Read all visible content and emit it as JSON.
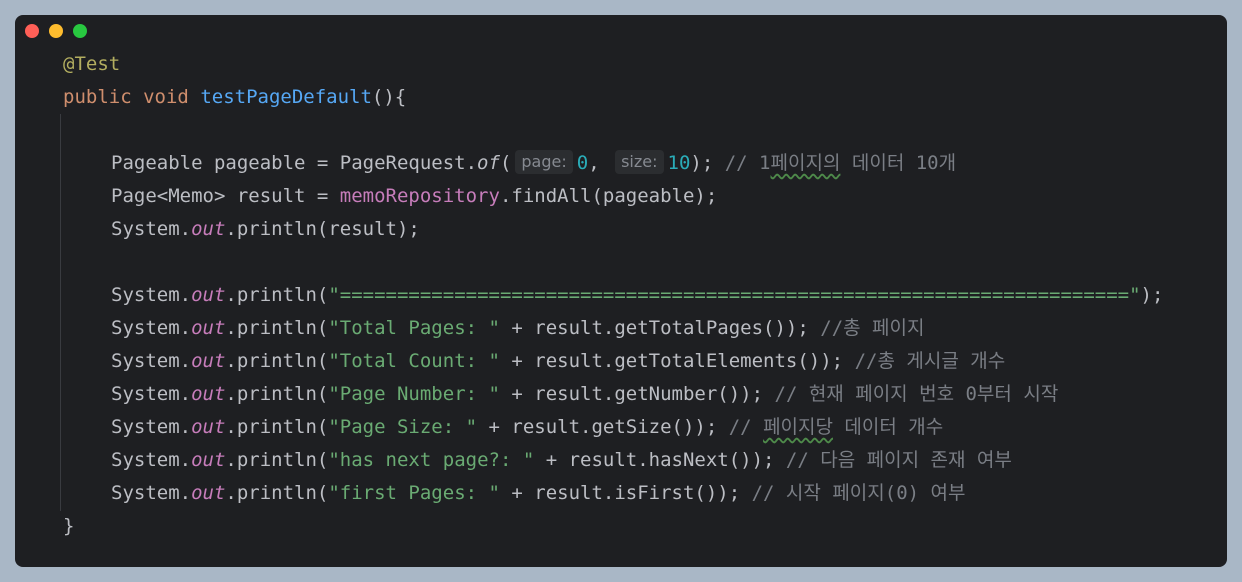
{
  "window": {
    "controls": [
      "close",
      "minimize",
      "maximize"
    ],
    "colors": {
      "background": "#1e1f22",
      "close": "#ff5f57",
      "minimize": "#febc2e",
      "maximize": "#28c840"
    }
  },
  "code": {
    "annotation": "@Test",
    "sig": {
      "kw1": "public",
      "kw2": "void",
      "method": "testPageDefault",
      "rest": "(){"
    },
    "l3": {
      "a": "Pageable pageable = PageRequest.",
      "of": "of",
      "paren": "(",
      "hint_page": "page:",
      "page_val": "0",
      "comma": ", ",
      "hint_size": "size:",
      "size_val": "10",
      "close": ");",
      "comment_a": " // 1",
      "comment_u": "페이지의",
      "comment_b": " 데이터 10개"
    },
    "l4": {
      "a": "Page<Memo> result = ",
      "repo": "memoRepository",
      "b": ".findAll(pageable);"
    },
    "l5": {
      "sys": "System.",
      "out": "out",
      "b": ".println(result);"
    },
    "l6": {
      "sys": "System.",
      "out": "out",
      "pre": ".println(",
      "str": "\"=====================================================================\"",
      "post": ");"
    },
    "l7": {
      "sys": "System.",
      "out": "out",
      "pre": ".println(",
      "str": "\"Total Pages: \"",
      "post": " + result.getTotalPages());",
      "cmt": " //총 페이지"
    },
    "l8": {
      "sys": "System.",
      "out": "out",
      "pre": ".println(",
      "str": "\"Total Count: \"",
      "post": " + result.getTotalElements());",
      "cmt": " //총 게시글 개수"
    },
    "l9": {
      "sys": "System.",
      "out": "out",
      "pre": ".println(",
      "str": "\"Page Number: \"",
      "post": " + result.getNumber());",
      "cmt": " // 현재 페이지 번호 0부터 시작"
    },
    "l10": {
      "sys": "System.",
      "out": "out",
      "pre": ".println(",
      "str": "\"Page Size: \"",
      "post": " + result.getSize());",
      "cmt_a": " // ",
      "cmt_u": "페이지당",
      "cmt_b": " 데이터 개수"
    },
    "l11": {
      "sys": "System.",
      "out": "out",
      "pre": ".println(",
      "str": "\"has next page?: \"",
      "post": " + result.hasNext());",
      "cmt": " // 다음 페이지 존재 여부"
    },
    "l12": {
      "sys": "System.",
      "out": "out",
      "pre": ".println(",
      "str": "\"first Pages: \"",
      "post": " + result.isFirst());",
      "cmt": " // 시작 페이지(0) 여부"
    },
    "closing": "}"
  }
}
